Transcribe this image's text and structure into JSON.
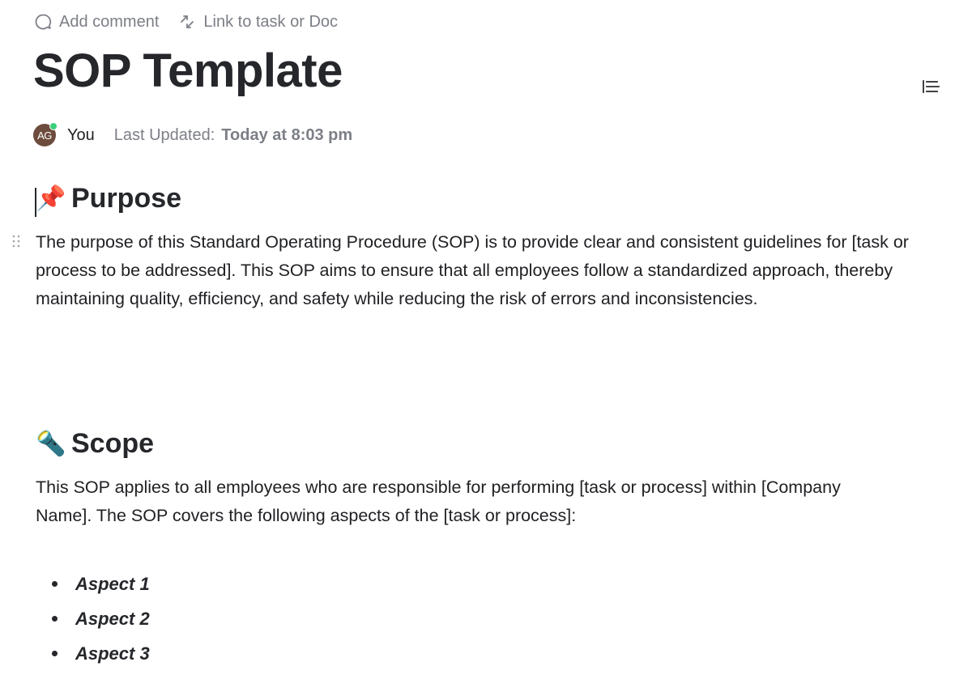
{
  "toolbar": {
    "add_comment": {
      "label": "Add comment",
      "icon": "comment-bubble-icon"
    },
    "link_task": {
      "label": "Link to task or Doc",
      "icon": "link-arrows-icon"
    }
  },
  "document": {
    "title": "SOP Template",
    "toc_icon": "table-of-contents-icon"
  },
  "meta": {
    "avatar_initials": "AG",
    "avatar_color": "#6d4c3d",
    "presence_color": "#3ccf7a",
    "author": "You",
    "updated_label": "Last Updated:",
    "updated_value": "Today at 8:03 pm"
  },
  "sections": [
    {
      "emoji": "📌",
      "emoji_name": "pushpin-icon",
      "heading": "Purpose",
      "paragraphs": [
        "The purpose of this Standard Operating Procedure (SOP) is to provide clear and consistent guidelines for [task or process to be addressed]. This SOP aims to ensure that all employees follow a standardized approach, thereby maintaining quality, efficiency, and safety while reducing the risk of errors and inconsistencies."
      ]
    },
    {
      "emoji": "🔦",
      "emoji_name": "flashlight-icon",
      "heading": "Scope",
      "paragraphs": [
        "This SOP applies to all employees who are responsible for performing [task or process] within [Company Name]. The SOP covers the following aspects of the [task or process]:"
      ],
      "bullets": [
        "Aspect 1",
        "Aspect 2",
        "Aspect 3"
      ]
    }
  ]
}
